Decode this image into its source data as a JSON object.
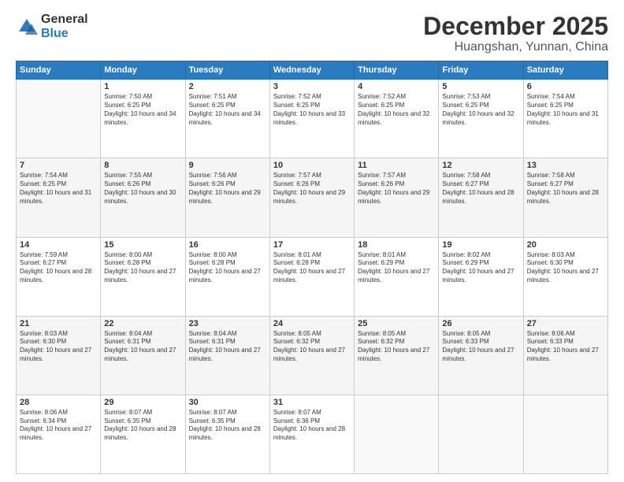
{
  "logo": {
    "general": "General",
    "blue": "Blue"
  },
  "header": {
    "title": "December 2025",
    "subtitle": "Huangshan, Yunnan, China"
  },
  "weekdays": [
    "Sunday",
    "Monday",
    "Tuesday",
    "Wednesday",
    "Thursday",
    "Friday",
    "Saturday"
  ],
  "weeks": [
    [
      {
        "day": null
      },
      {
        "day": "1",
        "sunrise": "7:50 AM",
        "sunset": "6:25 PM",
        "daylight": "10 hours and 34 minutes."
      },
      {
        "day": "2",
        "sunrise": "7:51 AM",
        "sunset": "6:25 PM",
        "daylight": "10 hours and 34 minutes."
      },
      {
        "day": "3",
        "sunrise": "7:52 AM",
        "sunset": "6:25 PM",
        "daylight": "10 hours and 33 minutes."
      },
      {
        "day": "4",
        "sunrise": "7:52 AM",
        "sunset": "6:25 PM",
        "daylight": "10 hours and 32 minutes."
      },
      {
        "day": "5",
        "sunrise": "7:53 AM",
        "sunset": "6:25 PM",
        "daylight": "10 hours and 32 minutes."
      },
      {
        "day": "6",
        "sunrise": "7:54 AM",
        "sunset": "6:25 PM",
        "daylight": "10 hours and 31 minutes."
      }
    ],
    [
      {
        "day": "7",
        "sunrise": "7:54 AM",
        "sunset": "6:25 PM",
        "daylight": "10 hours and 31 minutes."
      },
      {
        "day": "8",
        "sunrise": "7:55 AM",
        "sunset": "6:26 PM",
        "daylight": "10 hours and 30 minutes."
      },
      {
        "day": "9",
        "sunrise": "7:56 AM",
        "sunset": "6:26 PM",
        "daylight": "10 hours and 29 minutes."
      },
      {
        "day": "10",
        "sunrise": "7:57 AM",
        "sunset": "6:26 PM",
        "daylight": "10 hours and 29 minutes."
      },
      {
        "day": "11",
        "sunrise": "7:57 AM",
        "sunset": "6:26 PM",
        "daylight": "10 hours and 29 minutes."
      },
      {
        "day": "12",
        "sunrise": "7:58 AM",
        "sunset": "6:27 PM",
        "daylight": "10 hours and 28 minutes."
      },
      {
        "day": "13",
        "sunrise": "7:58 AM",
        "sunset": "6:27 PM",
        "daylight": "10 hours and 28 minutes."
      }
    ],
    [
      {
        "day": "14",
        "sunrise": "7:59 AM",
        "sunset": "6:27 PM",
        "daylight": "10 hours and 28 minutes."
      },
      {
        "day": "15",
        "sunrise": "8:00 AM",
        "sunset": "6:28 PM",
        "daylight": "10 hours and 27 minutes."
      },
      {
        "day": "16",
        "sunrise": "8:00 AM",
        "sunset": "6:28 PM",
        "daylight": "10 hours and 27 minutes."
      },
      {
        "day": "17",
        "sunrise": "8:01 AM",
        "sunset": "6:28 PM",
        "daylight": "10 hours and 27 minutes."
      },
      {
        "day": "18",
        "sunrise": "8:01 AM",
        "sunset": "6:29 PM",
        "daylight": "10 hours and 27 minutes."
      },
      {
        "day": "19",
        "sunrise": "8:02 AM",
        "sunset": "6:29 PM",
        "daylight": "10 hours and 27 minutes."
      },
      {
        "day": "20",
        "sunrise": "8:03 AM",
        "sunset": "6:30 PM",
        "daylight": "10 hours and 27 minutes."
      }
    ],
    [
      {
        "day": "21",
        "sunrise": "8:03 AM",
        "sunset": "6:30 PM",
        "daylight": "10 hours and 27 minutes."
      },
      {
        "day": "22",
        "sunrise": "8:04 AM",
        "sunset": "6:31 PM",
        "daylight": "10 hours and 27 minutes."
      },
      {
        "day": "23",
        "sunrise": "8:04 AM",
        "sunset": "6:31 PM",
        "daylight": "10 hours and 27 minutes."
      },
      {
        "day": "24",
        "sunrise": "8:05 AM",
        "sunset": "6:32 PM",
        "daylight": "10 hours and 27 minutes."
      },
      {
        "day": "25",
        "sunrise": "8:05 AM",
        "sunset": "6:32 PM",
        "daylight": "10 hours and 27 minutes."
      },
      {
        "day": "26",
        "sunrise": "8:05 AM",
        "sunset": "6:33 PM",
        "daylight": "10 hours and 27 minutes."
      },
      {
        "day": "27",
        "sunrise": "8:06 AM",
        "sunset": "6:33 PM",
        "daylight": "10 hours and 27 minutes."
      }
    ],
    [
      {
        "day": "28",
        "sunrise": "8:06 AM",
        "sunset": "6:34 PM",
        "daylight": "10 hours and 27 minutes."
      },
      {
        "day": "29",
        "sunrise": "8:07 AM",
        "sunset": "6:35 PM",
        "daylight": "10 hours and 28 minutes."
      },
      {
        "day": "30",
        "sunrise": "8:07 AM",
        "sunset": "6:35 PM",
        "daylight": "10 hours and 28 minutes."
      },
      {
        "day": "31",
        "sunrise": "8:07 AM",
        "sunset": "6:36 PM",
        "daylight": "10 hours and 28 minutes."
      },
      {
        "day": null
      },
      {
        "day": null
      },
      {
        "day": null
      }
    ]
  ]
}
